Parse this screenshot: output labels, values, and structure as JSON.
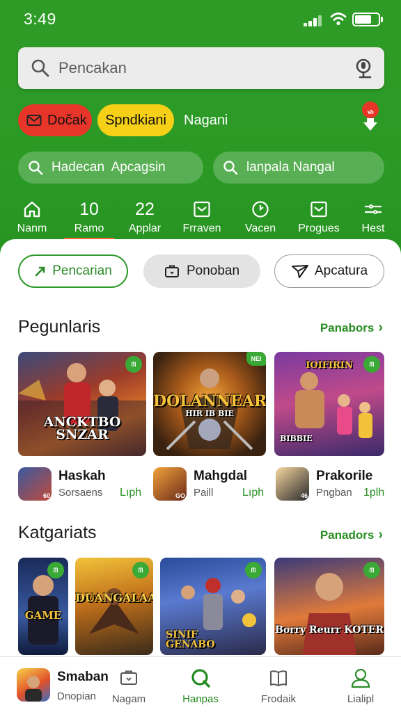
{
  "status_bar": {
    "time": "3:49"
  },
  "search": {
    "placeholder": "Pencakan"
  },
  "chips": [
    {
      "label": "Dočak",
      "color": "#e8352a"
    },
    {
      "label": "Spndkiani",
      "color": "#f5d017"
    },
    {
      "label": "Nagani"
    }
  ],
  "notification": {
    "badge": "Ꮧ"
  },
  "search_bars": [
    {
      "label": "Hadecan  Apcagsin"
    },
    {
      "label": "lanpala Nangal"
    }
  ],
  "categories": [
    {
      "icon": "home-icon",
      "label": "Nanm"
    },
    {
      "icon": "number",
      "value": "10",
      "label": "Ramo",
      "active": true
    },
    {
      "icon": "number",
      "value": "22",
      "label": "Applar"
    },
    {
      "icon": "inbox-icon",
      "label": "Frraven"
    },
    {
      "icon": "clock-icon",
      "label": "Vacen"
    },
    {
      "icon": "inbox-icon",
      "label": "Progues"
    },
    {
      "icon": "tools-icon",
      "label": "Hest"
    }
  ],
  "filters": [
    {
      "label": "Pencarian",
      "style": "outline-green"
    },
    {
      "label": "Ponoban",
      "style": "grey"
    },
    {
      "label": "Apcatura",
      "style": "outline-grey"
    }
  ],
  "section_popular": {
    "title": "Pegunlaris",
    "link": "Panabors",
    "cards": [
      {
        "art_text": "ANCKTBO SNZAR",
        "badge": "ᗰ"
      },
      {
        "art_text": "DOLANNEAR",
        "art_sub": "HIR IB BIE",
        "badge": "NEI"
      },
      {
        "art_text": "IOIFIRIN",
        "art_sub": "BIBBIE",
        "badge": "ᗰ"
      }
    ],
    "apps": [
      {
        "name": "Haskah",
        "sub": "Sorsaens",
        "size": "Lıph",
        "icon_badge": "60"
      },
      {
        "name": "Mahgdal",
        "sub": "Paill",
        "size": "Lıph",
        "icon_badge": "GO"
      },
      {
        "name": "Prakorile",
        "sub": "Pngban",
        "size": "1plh",
        "icon_badge": "46"
      }
    ]
  },
  "section_categories": {
    "title": "Katgariats",
    "link": "Panadors",
    "cards": [
      {
        "art_text": "GAME",
        "badge": "ᗰ"
      },
      {
        "art_text": "DUANGALAA",
        "badge": "ᗰ"
      },
      {
        "art_text": "SINIF GENABO",
        "badge": "ᗰ"
      },
      {
        "art_text": "Borry Reurr KOTER",
        "badge": "ᗰ"
      }
    ]
  },
  "bottom_nav": {
    "profile_name": "Smaban",
    "profile_sub": "Dnopian",
    "items": [
      {
        "icon": "briefcase-icon",
        "label": "Nagam"
      },
      {
        "icon": "search-icon",
        "label": "Hanpas",
        "active": true
      },
      {
        "icon": "book-icon",
        "label": "Frodaik"
      },
      {
        "icon": "user-icon",
        "label": "Lialipl"
      }
    ]
  },
  "colors": {
    "primary_green": "#2b9a25",
    "accent_red": "#e8352a",
    "accent_yellow": "#f5d017",
    "link_green": "#2a8f23"
  }
}
